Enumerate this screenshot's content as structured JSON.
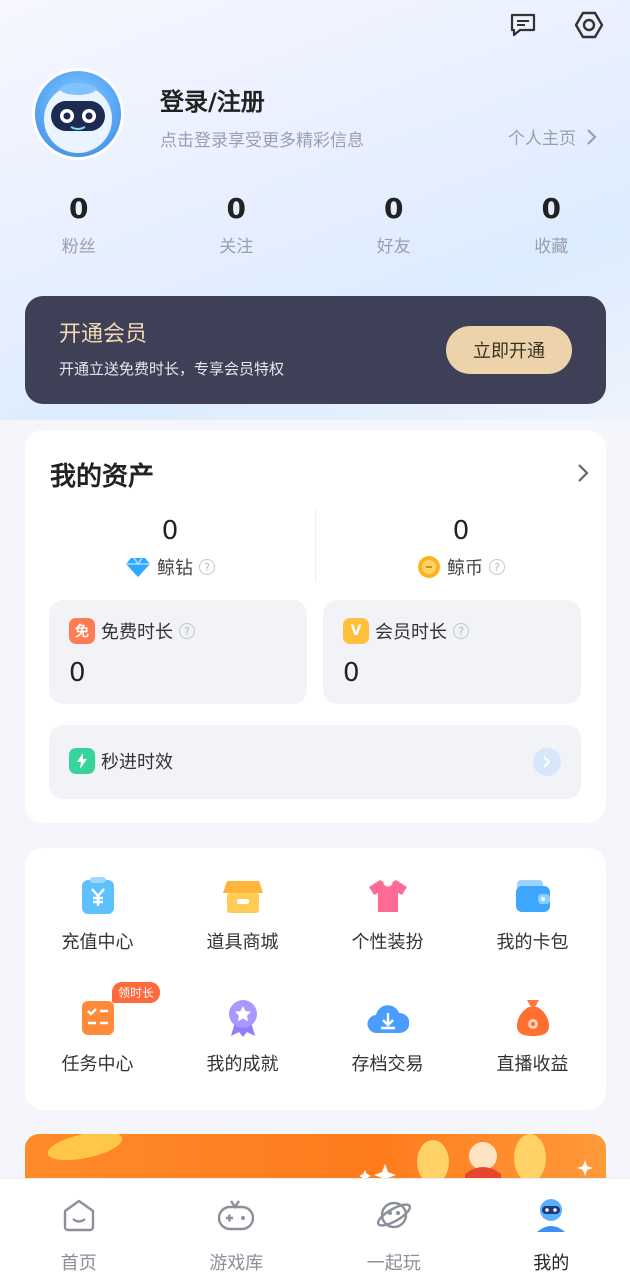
{
  "header": {
    "icons": [
      "message-icon",
      "settings-icon"
    ]
  },
  "profile": {
    "title": "登录/注册",
    "subtitle": "点击登录享受更多精彩信息",
    "home_link": "个人主页"
  },
  "stats": [
    {
      "value": "0",
      "label": "粉丝"
    },
    {
      "value": "0",
      "label": "关注"
    },
    {
      "value": "0",
      "label": "好友"
    },
    {
      "value": "0",
      "label": "收藏"
    }
  ],
  "vip": {
    "title": "开通会员",
    "subtitle": "开通立送免费时长，专享会员特权",
    "button": "立即开通",
    "bg_color": "#3d4056",
    "accent": "#ecd3ab"
  },
  "assets": {
    "title": "我的资产",
    "currencies": [
      {
        "value": "0",
        "label": "鲸钻",
        "icon": "diamond-icon"
      },
      {
        "value": "0",
        "label": "鲸币",
        "icon": "coin-icon"
      }
    ],
    "durations": [
      {
        "label": "免费时长",
        "value": "0",
        "icon": "free-badge-icon",
        "badge": "免"
      },
      {
        "label": "会员时长",
        "value": "0",
        "icon": "vip-badge-icon",
        "badge": "V"
      }
    ],
    "fast": {
      "label": "秒进时效",
      "icon": "lightning-icon"
    }
  },
  "menu": {
    "items": [
      {
        "label": "充值中心",
        "icon": "recharge-icon"
      },
      {
        "label": "道具商城",
        "icon": "shop-icon"
      },
      {
        "label": "个性装扮",
        "icon": "outfit-icon"
      },
      {
        "label": "我的卡包",
        "icon": "wallet-icon"
      },
      {
        "label": "任务中心",
        "icon": "task-icon",
        "tag": "领时长"
      },
      {
        "label": "我的成就",
        "icon": "medal-icon"
      },
      {
        "label": "存档交易",
        "icon": "cloud-download-icon"
      },
      {
        "label": "直播收益",
        "icon": "money-bag-icon"
      }
    ]
  },
  "tabbar": {
    "tabs": [
      {
        "label": "首页",
        "icon": "home-icon"
      },
      {
        "label": "游戏库",
        "icon": "gamepad-icon"
      },
      {
        "label": "一起玩",
        "icon": "planet-icon"
      },
      {
        "label": "我的",
        "icon": "user-icon",
        "active": true
      }
    ]
  }
}
